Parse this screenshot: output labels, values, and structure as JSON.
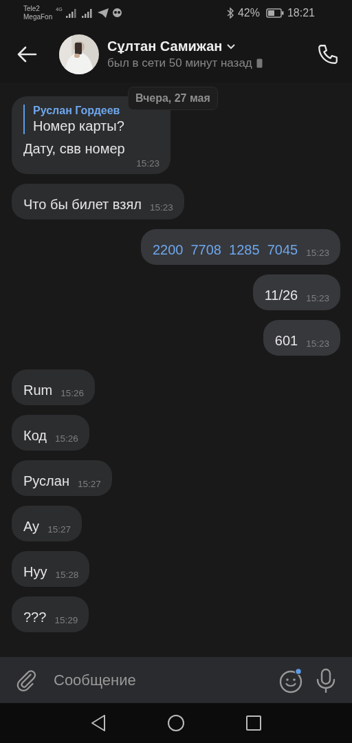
{
  "status_bar": {
    "carriers": [
      "Tele2",
      "MegaFon"
    ],
    "network": "4G",
    "battery": "42%",
    "time": "18:21"
  },
  "header": {
    "name": "Сұлтан Самижан",
    "status": "был в сети 50 минут назад"
  },
  "date_badge": "Вчера, 27 мая",
  "messages": [
    {
      "outgoing": false,
      "reply": {
        "author": "Руслан Гордеев",
        "text": "Номер карты?"
      },
      "text": "Дату, свв номер",
      "time": "15:23",
      "link": false
    },
    {
      "outgoing": false,
      "text": "Что бы билет взял",
      "time": "15:23",
      "link": false
    },
    {
      "outgoing": true,
      "text": "2200  7708  1285  7045",
      "time": "15:23",
      "link": true
    },
    {
      "outgoing": true,
      "text": "11/26",
      "time": "15:23",
      "link": false
    },
    {
      "outgoing": true,
      "text": "601",
      "time": "15:23",
      "link": false
    },
    {
      "outgoing": false,
      "text": "Rum",
      "time": "15:26",
      "link": false
    },
    {
      "outgoing": false,
      "text": "Код",
      "time": "15:26",
      "link": false
    },
    {
      "outgoing": false,
      "text": "Руслан",
      "time": "15:27",
      "link": false
    },
    {
      "outgoing": false,
      "text": "Ау",
      "time": "15:27",
      "link": false
    },
    {
      "outgoing": false,
      "text": "Нуу",
      "time": "15:28",
      "link": false
    },
    {
      "outgoing": false,
      "text": "???",
      "time": "15:29",
      "link": false
    }
  ],
  "composer": {
    "placeholder": "Сообщение",
    "emoji_notification": true
  }
}
